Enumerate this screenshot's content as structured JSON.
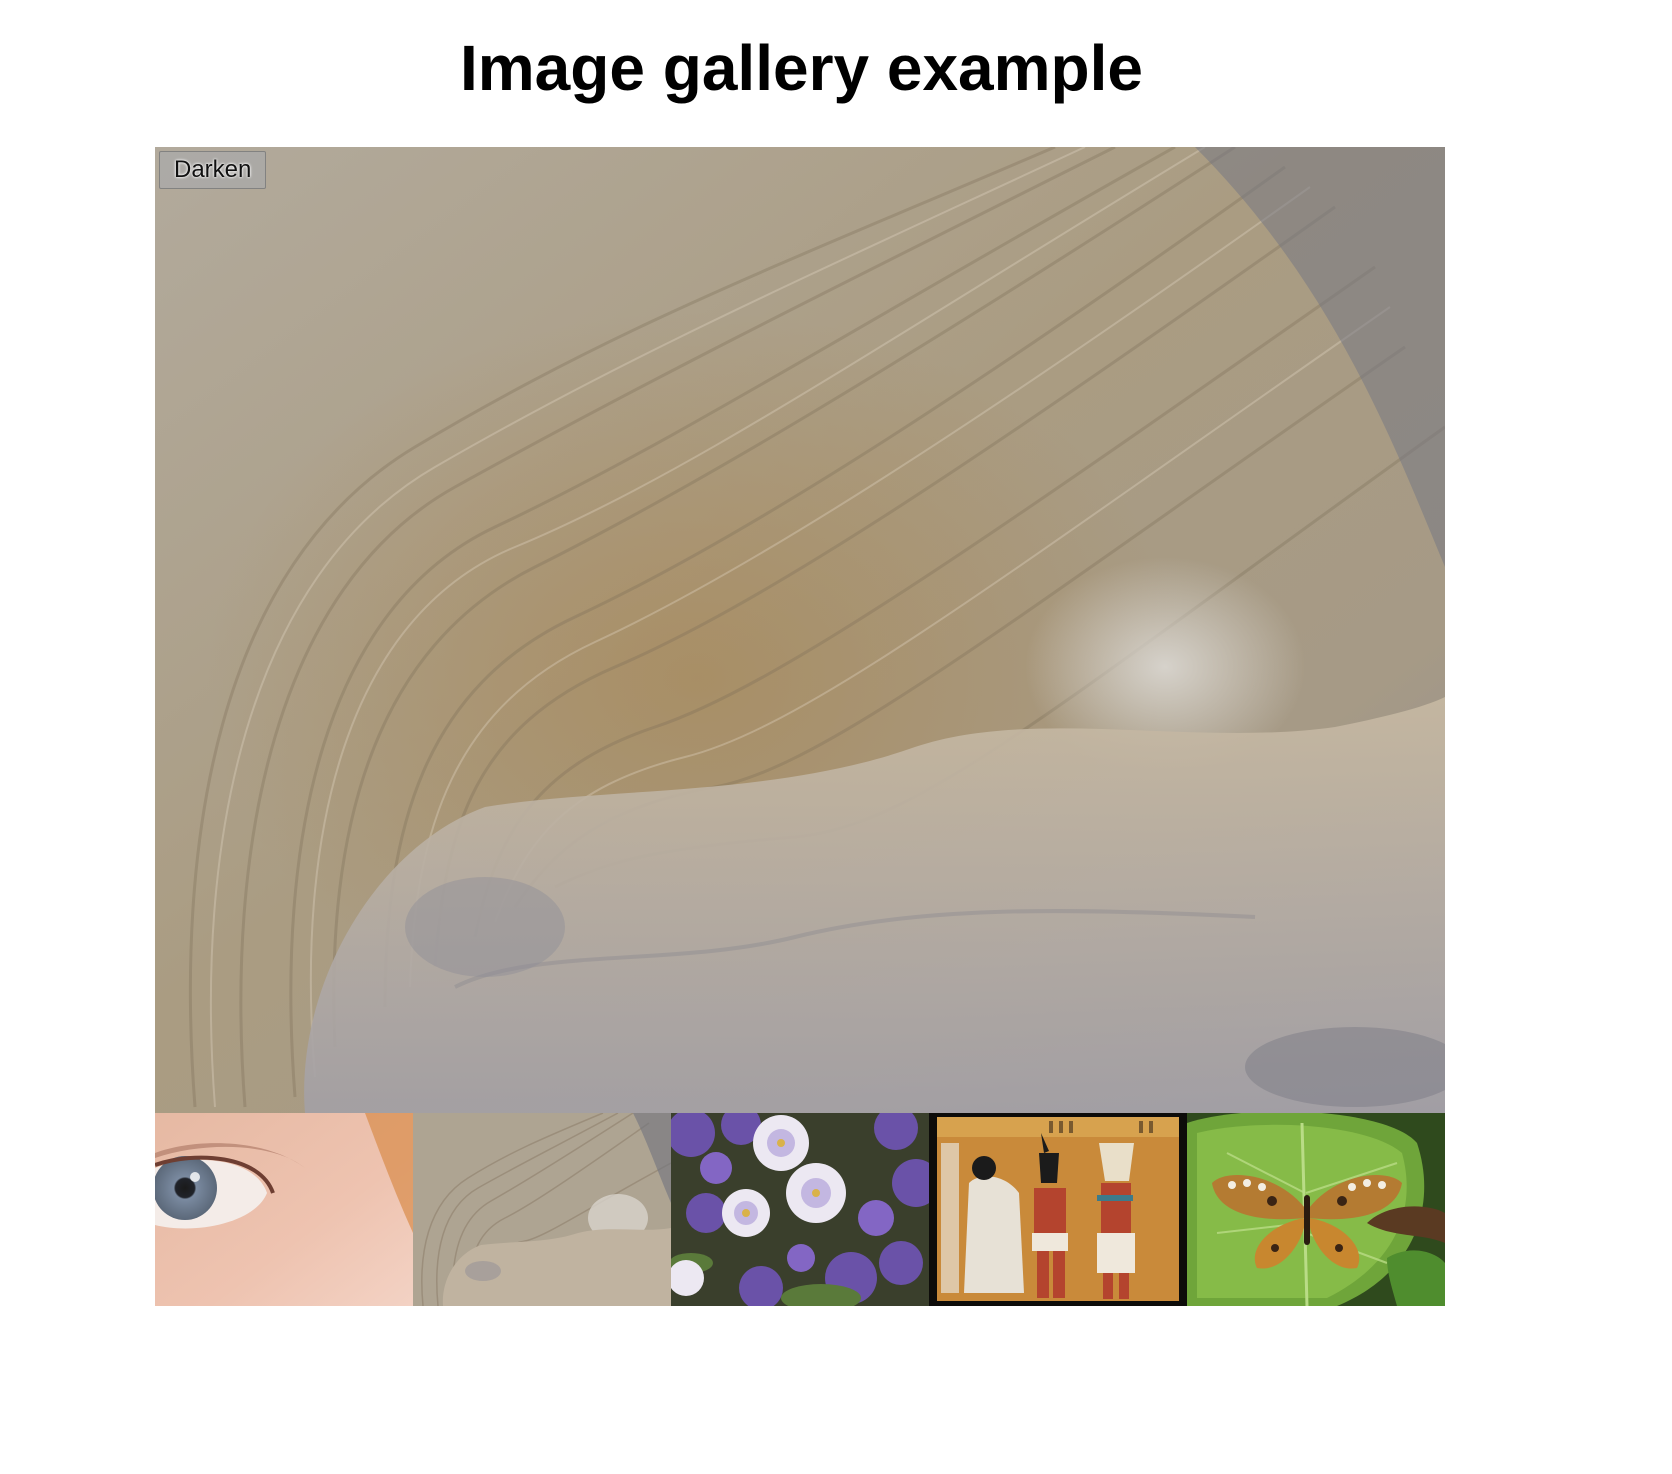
{
  "page": {
    "title": "Image gallery example"
  },
  "displayed_image": {
    "subject": "sandstone rock formation",
    "icon": "sandstone-photo"
  },
  "darken_button": {
    "label": "Darken"
  },
  "thumbnails": [
    {
      "subject": "eye",
      "icon": "eye-photo"
    },
    {
      "subject": "sandstone rock",
      "icon": "sandstone-photo"
    },
    {
      "subject": "purple and white flowers",
      "icon": "flowers-photo"
    },
    {
      "subject": "egyptian wall painting",
      "icon": "egyptian-painting-photo"
    },
    {
      "subject": "butterfly on leaf",
      "icon": "butterfly-photo"
    }
  ],
  "colors": {
    "page_background": "#ffffff",
    "title_text": "#000000",
    "button_background": "#aaaaaa"
  }
}
